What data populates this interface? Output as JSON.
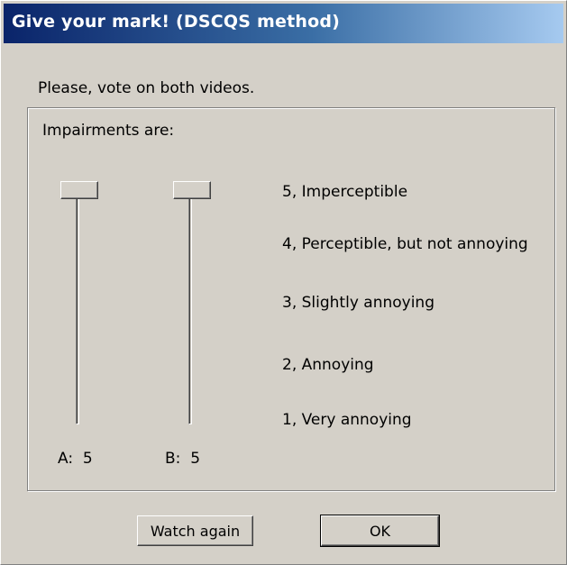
{
  "window": {
    "title": "Give your mark! (DSCQS method)"
  },
  "instruction": "Please, vote on both videos.",
  "group": {
    "label": "Impairments are:"
  },
  "sliders": [
    {
      "label": "A:",
      "value": "5"
    },
    {
      "label": "B:",
      "value": "5"
    }
  ],
  "scale": [
    "5, Imperceptible",
    "4, Perceptible, but not annoying",
    "3, Slightly annoying",
    "2, Annoying",
    "1, Very annoying"
  ],
  "buttons": {
    "watch_again": "Watch again",
    "ok": "OK"
  },
  "colors": {
    "title_gradient_start": "#0a246a",
    "title_gradient_end": "#a6caf0",
    "face": "#d4d0c8"
  }
}
